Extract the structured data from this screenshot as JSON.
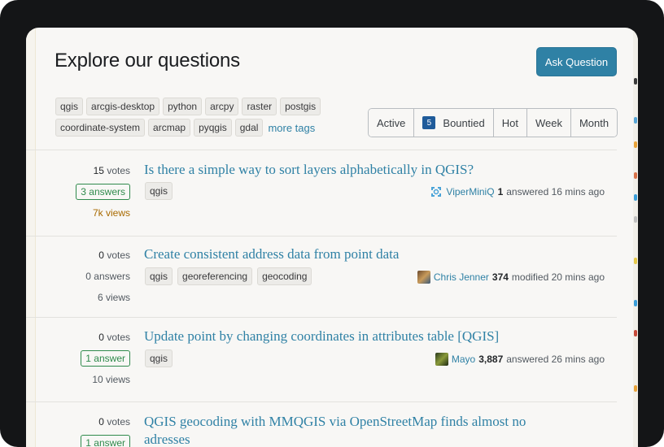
{
  "header": {
    "title": "Explore our questions",
    "ask_button": "Ask Question"
  },
  "tags": {
    "row1": [
      "qgis",
      "arcgis-desktop",
      "python",
      "arcpy",
      "raster",
      "postgis"
    ],
    "row2": [
      "coordinate-system",
      "arcmap",
      "pyqgis",
      "gdal"
    ],
    "more_label": "more tags"
  },
  "filters": {
    "active": "Active",
    "bounty_count": "5",
    "bountied": "Bountied",
    "hot": "Hot",
    "week": "Week",
    "month": "Month"
  },
  "questions": [
    {
      "votes_num": "15",
      "votes_label": "votes",
      "answers_text": "3 answers",
      "views_text": "7k views",
      "title": "Is there a simple way to sort layers alphabetically in QGIS?",
      "tags": [
        "qgis"
      ],
      "user": "ViperMiniQ",
      "rep": "1",
      "action": "answered 16 mins ago"
    },
    {
      "votes_num": "0",
      "votes_label": "votes",
      "answers_text": "0 answers",
      "views_text": "6 views",
      "title": "Create consistent address data from point data",
      "tags": [
        "qgis",
        "georeferencing",
        "geocoding"
      ],
      "user": "Chris Jenner",
      "rep": "374",
      "action": "modified 20 mins ago"
    },
    {
      "votes_num": "0",
      "votes_label": "votes",
      "answers_text": "1 answer",
      "views_text": "10 views",
      "title": "Update point by changing coordinates in attributes table [QGIS]",
      "tags": [
        "qgis"
      ],
      "user": "Mayo",
      "rep": "3,887",
      "action": "answered 26 mins ago"
    },
    {
      "votes_num": "0",
      "votes_label": "votes",
      "answers_text": "1 answer",
      "title_line1": "QGIS geocoding with MMQGIS via OpenStreetMap finds almost no",
      "title_line2": "adresses"
    }
  ],
  "colors": {
    "accent": "#2f81a5",
    "answered": "#2f8a4c",
    "hot_views": "#a86a00",
    "bounty": "#1f5b9a"
  },
  "icons": {
    "q1_avatar": "identicon-avatar",
    "q2_avatar": "photo-avatar",
    "q3_avatar": "photo-avatar"
  }
}
